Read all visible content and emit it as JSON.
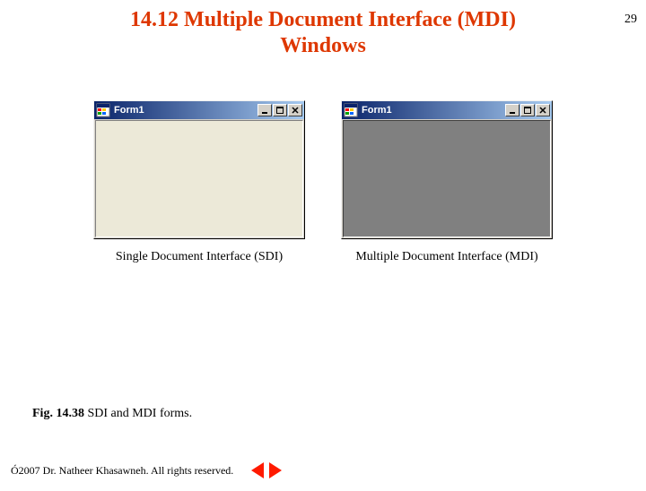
{
  "page_number": "29",
  "heading_line1": "14.12  Multiple Document Interface (MDI)",
  "heading_line2": "Windows",
  "windows": {
    "left": {
      "title": "Form1",
      "caption": "Single Document Interface (SDI)"
    },
    "right": {
      "title": "Form1",
      "caption": "Multiple Document Interface (MDI)"
    }
  },
  "figure": {
    "label": "Fig. 14.38",
    "text": " SDI and MDI forms."
  },
  "footer": {
    "copyright": "Ó",
    "text": " 2007 Dr. Natheer Khasawneh.  All rights reserved."
  }
}
